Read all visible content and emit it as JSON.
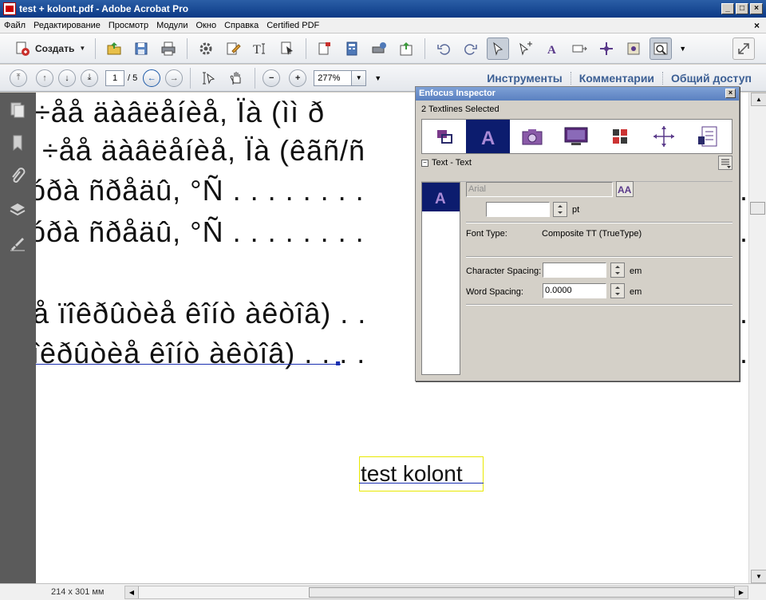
{
  "window": {
    "title": "test + kolont.pdf - Adobe Acrobat Pro"
  },
  "menubar": {
    "items": [
      "Файл",
      "Редактирование",
      "Просмотр",
      "Модули",
      "Окно",
      "Справка",
      "Certified PDF"
    ],
    "close_doc": "×"
  },
  "toolbar": {
    "create_label": "Создать"
  },
  "navigation": {
    "current_page": "1",
    "total_pages": "/ 5",
    "zoom": "277%"
  },
  "task_links": {
    "tools": "Инструменты",
    "comments": "Комментарии",
    "share": "Общий доступ"
  },
  "document": {
    "lines": [
      "÷åå äàâëåíèå,  Ïà  (ìì   ð",
      "ì ÷åå äàâëåíèå,  Ïà  (êãñ/ñ",
      "óðà ñðåäû, °Ñ . . . . . . . .",
      "óðà ñðåäû, °Ñ . . . . . . . .",
      "å   ïîêðûòèå   êîíò àêòîâ) . .",
      "îêðûòèå   êîíò àêòîâ) . . . ."
    ],
    "right_dots": [
      ".",
      ".",
      ".",
      "."
    ],
    "footer_text": "test kolont"
  },
  "status": {
    "page_size": "214 x 301 мм"
  },
  "inspector": {
    "title": "Enfocus Inspector",
    "selection": "2 Textlines Selected",
    "section": "Text - Text",
    "font_name": "Arial",
    "font_size": "",
    "font_size_unit": "pt",
    "font_type_label": "Font Type:",
    "font_type_value": "Composite TT (TrueType)",
    "char_spacing_label": "Character Spacing:",
    "char_spacing_value": "",
    "char_spacing_unit": "em",
    "word_spacing_label": "Word Spacing:",
    "word_spacing_value": "0.0000",
    "word_spacing_unit": "em"
  },
  "colors": {
    "titlebar": "#0b3a86",
    "inspector_active_tab": "#0c1c6e",
    "selection_underline": "#1a2fb0",
    "task_link": "#3c5f94"
  }
}
